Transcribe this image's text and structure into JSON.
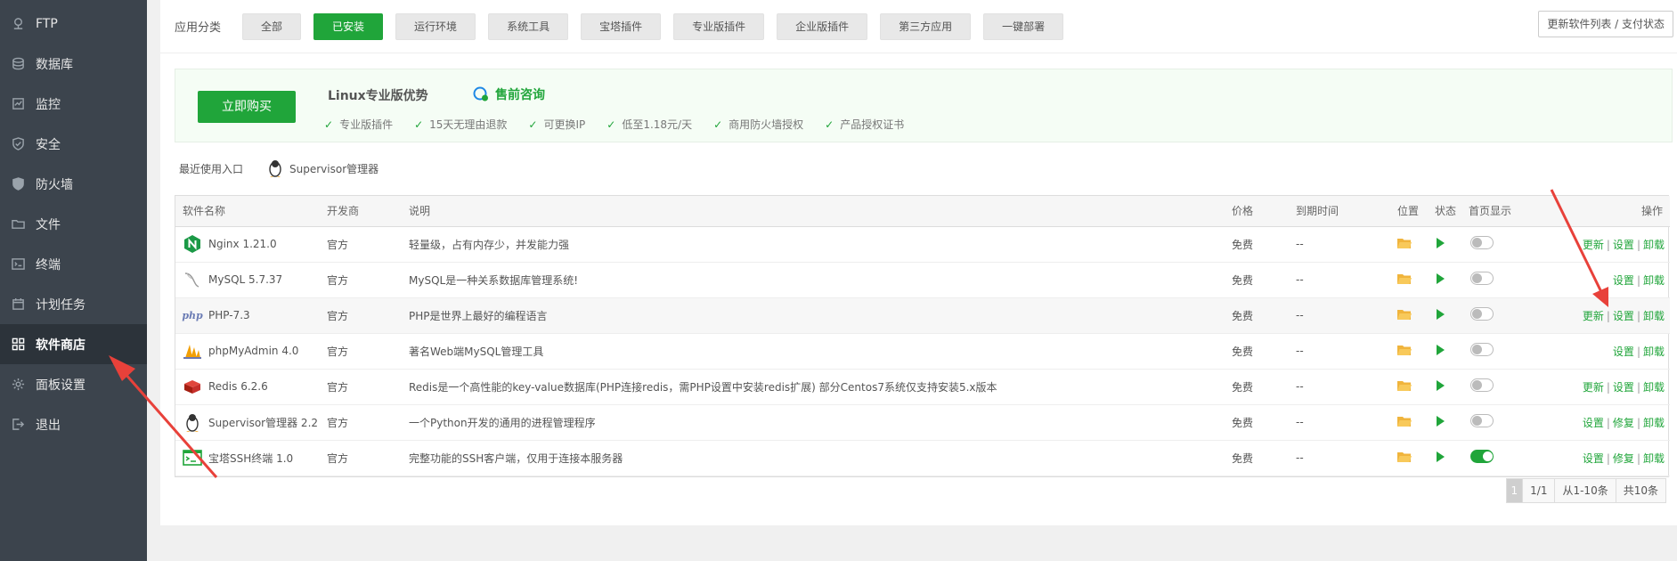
{
  "sidebar": {
    "items": [
      {
        "label": "FTP",
        "icon": "ftp-icon"
      },
      {
        "label": "数据库",
        "icon": "database-icon"
      },
      {
        "label": "监控",
        "icon": "monitor-icon"
      },
      {
        "label": "安全",
        "icon": "shield-icon"
      },
      {
        "label": "防火墙",
        "icon": "firewall-icon"
      },
      {
        "label": "文件",
        "icon": "folder-icon"
      },
      {
        "label": "终端",
        "icon": "terminal-icon"
      },
      {
        "label": "计划任务",
        "icon": "calendar-icon"
      },
      {
        "label": "软件商店",
        "icon": "grid-icon",
        "active": true
      },
      {
        "label": "面板设置",
        "icon": "gear-icon"
      },
      {
        "label": "退出",
        "icon": "logout-icon"
      }
    ]
  },
  "categories": {
    "label": "应用分类",
    "tabs": [
      "全部",
      "已安装",
      "运行环境",
      "系统工具",
      "宝塔插件",
      "专业版插件",
      "企业版插件",
      "第三方应用",
      "一键部署"
    ],
    "active": "已安装",
    "update_button": "更新软件列表 / 支付状态"
  },
  "promo": {
    "buy_button": "立即购买",
    "title": "Linux专业版优势",
    "consult": "售前咨询",
    "features": [
      "专业版插件",
      "15天无理由退款",
      "可更换IP",
      "低至1.18元/天",
      "商用防火墙授权",
      "产品授权证书"
    ]
  },
  "recent": {
    "label": "最近使用入口",
    "item": "Supervisor管理器"
  },
  "table": {
    "headers": [
      "软件名称",
      "开发商",
      "说明",
      "价格",
      "到期时间",
      "位置",
      "状态",
      "首页显示",
      "操作"
    ],
    "rows": [
      {
        "name": "Nginx 1.21.0",
        "icon": "nginx-icon",
        "vendor": "官方",
        "desc": "轻量级，占有内存少，并发能力强",
        "price": "免费",
        "expire": "--",
        "home": false,
        "ops": [
          "更新",
          "设置",
          "卸载"
        ]
      },
      {
        "name": "MySQL 5.7.37",
        "icon": "mysql-icon",
        "vendor": "官方",
        "desc": "MySQL是一种关系数据库管理系统!",
        "price": "免费",
        "expire": "--",
        "home": false,
        "ops": [
          "设置",
          "卸载"
        ]
      },
      {
        "name": "PHP-7.3",
        "icon": "php-icon",
        "vendor": "官方",
        "desc": "PHP是世界上最好的编程语言",
        "price": "免费",
        "expire": "--",
        "home": false,
        "ops": [
          "更新",
          "设置",
          "卸载"
        ],
        "highlight": true
      },
      {
        "name": "phpMyAdmin 4.0",
        "icon": "phpmyadmin-icon",
        "vendor": "官方",
        "desc": "著名Web端MySQL管理工具",
        "price": "免费",
        "expire": "--",
        "home": false,
        "ops": [
          "设置",
          "卸载"
        ]
      },
      {
        "name": "Redis 6.2.6",
        "icon": "redis-icon",
        "vendor": "官方",
        "desc": "Redis是一个高性能的key-value数据库(PHP连接redis，需PHP设置中安装redis扩展) 部分Centos7系统仅支持安装5.x版本",
        "price": "免费",
        "expire": "--",
        "home": false,
        "ops": [
          "更新",
          "设置",
          "卸载"
        ]
      },
      {
        "name": "Supervisor管理器 2.2",
        "icon": "supervisor-icon",
        "vendor": "官方",
        "desc": "一个Python开发的通用的进程管理程序",
        "price": "免费",
        "expire": "--",
        "home": false,
        "ops": [
          "设置",
          "修复",
          "卸载"
        ]
      },
      {
        "name": "宝塔SSH终端 1.0",
        "icon": "ssh-terminal-icon",
        "vendor": "官方",
        "desc": "完整功能的SSH客户端，仅用于连接本服务器",
        "price": "免费",
        "expire": "--",
        "home": true,
        "ops": [
          "设置",
          "修复",
          "卸载"
        ]
      }
    ]
  },
  "pagination": [
    "1",
    "1/1",
    "从1-10条",
    "共10条"
  ],
  "colors": {
    "accent": "#20a53a",
    "sidebar": "#3c444d",
    "arrow": "#e8413a"
  }
}
